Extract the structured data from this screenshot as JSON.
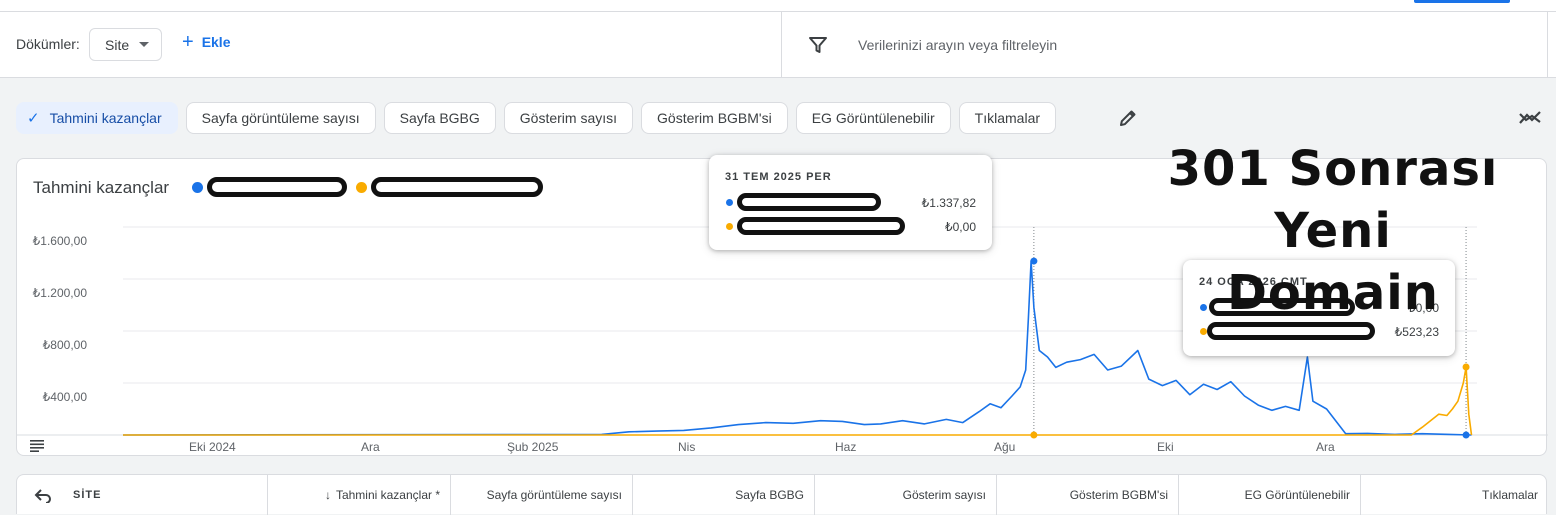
{
  "toolbar": {
    "dimensions_label": "Dökümler:",
    "dimension_value": "Site",
    "add_label": "Ekle",
    "search_placeholder": "Verilerinizi arayın veya filtreleyin"
  },
  "metric_chips": [
    {
      "label": "Tahmini kazançlar",
      "active": true
    },
    {
      "label": "Sayfa görüntüleme sayısı",
      "active": false
    },
    {
      "label": "Sayfa BGBG",
      "active": false
    },
    {
      "label": "Gösterim sayısı",
      "active": false
    },
    {
      "label": "Gösterim BGBM'si",
      "active": false
    },
    {
      "label": "EG Görüntülenebilir",
      "active": false
    },
    {
      "label": "Tıklamalar",
      "active": false
    }
  ],
  "chart": {
    "title": "Tahmini kazançlar",
    "overlay_text_line1": "301 Sonrası",
    "overlay_text_line2": "Yeni Domain",
    "colors": {
      "series1": "#1a73e8",
      "series2": "#f9ab00",
      "grid": "#e8eaed",
      "cursor": "#80868b"
    }
  },
  "tooltips": [
    {
      "date": "31 TEM 2025 PER",
      "value1": "₺1.337,82",
      "value2": "₺0,00"
    },
    {
      "date": "24 OCA 2026 CMT",
      "value1": "₺0,00",
      "value2": "₺523,23"
    }
  ],
  "chart_data": {
    "type": "line",
    "title": "Tahmini kazançlar",
    "y_tick_labels": [
      "₺1.600,00",
      "₺1.200,00",
      "₺800,00",
      "₺400,00"
    ],
    "y_ticks": [
      1600,
      1200,
      800,
      400
    ],
    "ylim": [
      0,
      1600
    ],
    "x_tick_labels": [
      "Eki 2024",
      "Ara",
      "Şub 2025",
      "Nis",
      "Haz",
      "Ağu",
      "Eki",
      "Ara"
    ],
    "x_tick_days": [
      15,
      76,
      138,
      195,
      256,
      318,
      379,
      440
    ],
    "x_range_days": [
      -15,
      480
    ],
    "grid": true,
    "legend": "top-left",
    "series": [
      {
        "x": [
          -15,
          160,
          170,
          180,
          190,
          200,
          210,
          220,
          230,
          240,
          248,
          256,
          262,
          270,
          278,
          286,
          292,
          298,
          302,
          306,
          310,
          313,
          315,
          316,
          317,
          318,
          320,
          323,
          326,
          330,
          335,
          340,
          345,
          350,
          356,
          360,
          365,
          370,
          375,
          380,
          385,
          390,
          395,
          400,
          405,
          410,
          415,
          418,
          420,
          425,
          432,
          440,
          450,
          460,
          470,
          478
        ],
        "y": [
          0,
          5,
          25,
          30,
          35,
          55,
          80,
          95,
          90,
          110,
          105,
          80,
          85,
          110,
          85,
          120,
          95,
          180,
          240,
          210,
          300,
          370,
          500,
          900,
          1337.82,
          980,
          650,
          600,
          520,
          560,
          580,
          620,
          500,
          530,
          650,
          430,
          380,
          420,
          310,
          390,
          350,
          410,
          300,
          230,
          190,
          220,
          190,
          600,
          260,
          200,
          10,
          12,
          5,
          10,
          5,
          0
        ]
      },
      {
        "x": [
          -15,
          456,
          460,
          463,
          466,
          469,
          471,
          473,
          475,
          476,
          477,
          478
        ],
        "y": [
          0,
          0,
          60,
          110,
          160,
          150,
          200,
          260,
          400,
          523.23,
          160,
          0
        ]
      }
    ]
  },
  "table": {
    "columns": [
      {
        "label": "SİTE"
      },
      {
        "label": "Tahmini kazançlar *",
        "sorted": "↓"
      },
      {
        "label": "Sayfa görüntüleme sayısı"
      },
      {
        "label": "Sayfa BGBG"
      },
      {
        "label": "Gösterim sayısı"
      },
      {
        "label": "Gösterim BGBM'si"
      },
      {
        "label": "EG Görüntülenebilir"
      },
      {
        "label": "Tıklamalar"
      }
    ]
  }
}
